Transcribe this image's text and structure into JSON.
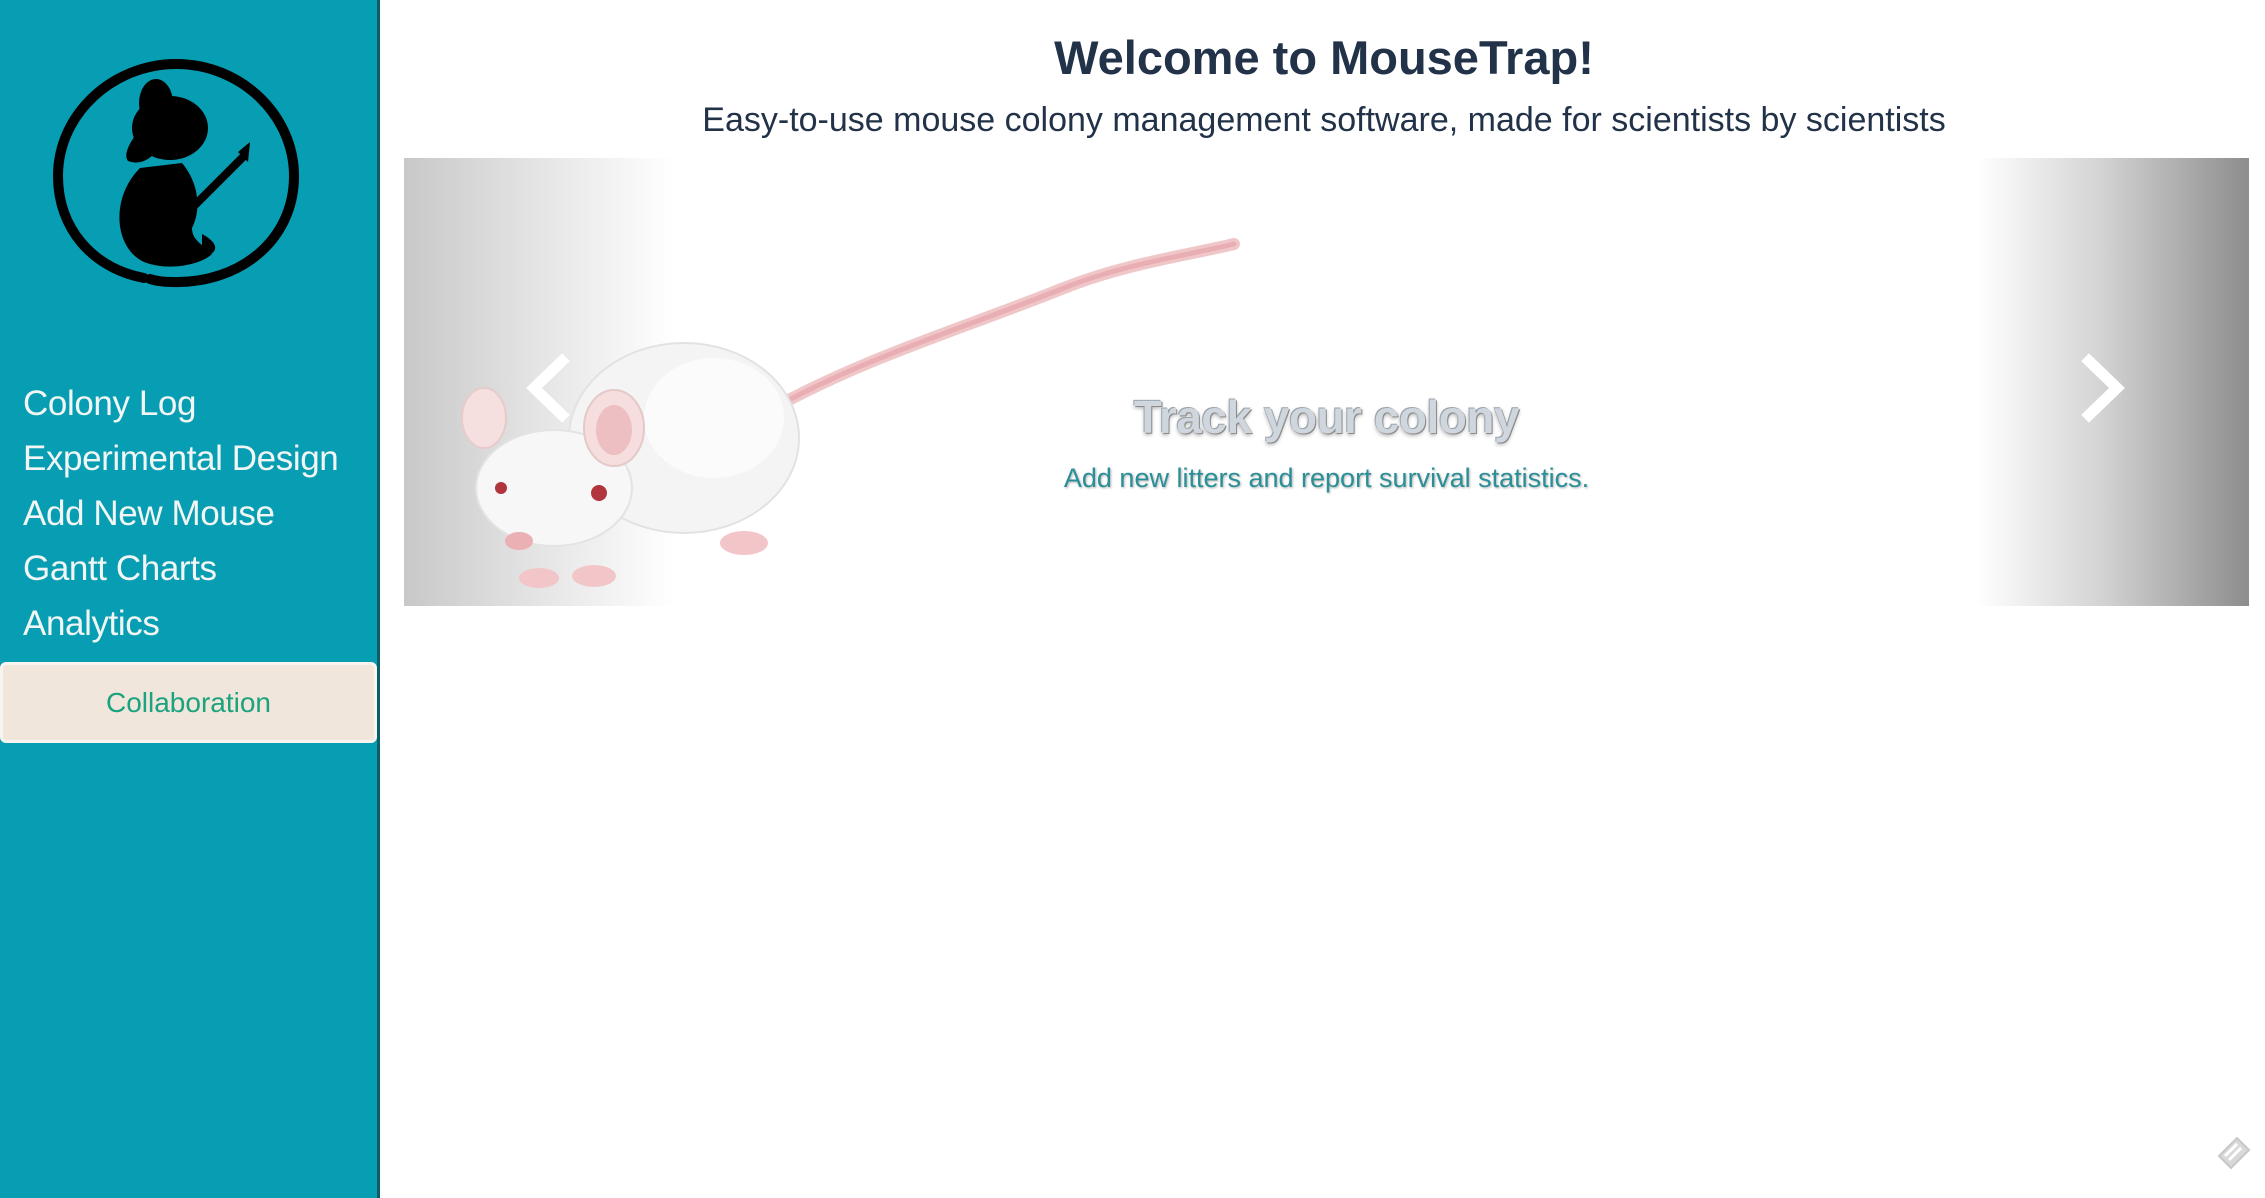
{
  "header": {
    "title": "Welcome to MouseTrap!",
    "subtitle": "Easy-to-use mouse colony management software, made for scientists by scientists"
  },
  "sidebar": {
    "logo_icon": "mouse-holding-pencil-logo",
    "items": [
      {
        "label": "Colony Log"
      },
      {
        "label": "Experimental Design"
      },
      {
        "label": "Add New Mouse"
      },
      {
        "label": "Gantt Charts"
      },
      {
        "label": "Analytics"
      }
    ],
    "active_item": {
      "label": "Collaboration"
    }
  },
  "carousel": {
    "slide": {
      "title": "Track your colony",
      "text": "Add new litters and report survival statistics."
    },
    "prev_icon": "chevron-left-icon",
    "next_icon": "chevron-right-icon"
  },
  "colors": {
    "sidebar_bg": "#079db3",
    "active_bg": "#f1e6db",
    "active_text": "#19a37e",
    "heading_text": "#223248",
    "caption_accent": "#2a8f97"
  }
}
